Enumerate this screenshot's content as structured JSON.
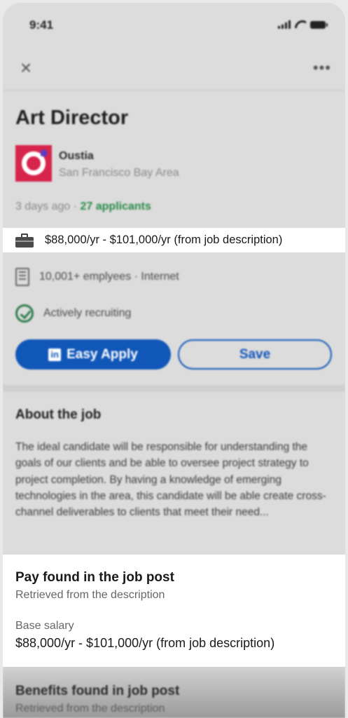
{
  "status_bar": {
    "time": "9:41"
  },
  "nav": {
    "close_glyph": "×",
    "more_glyph": "•••"
  },
  "job": {
    "title": "Art Director",
    "company": "Oustia",
    "location": "San Francisco Bay Area",
    "posted": "3 days ago",
    "separator": " · ",
    "applicants": "27 applicants"
  },
  "salary_highlight": "$88,000/yr - $101,000/yr (from job description)",
  "details": {
    "employees": "10,001+ emplyees · Internet",
    "recruiting": "Actively recruiting"
  },
  "actions": {
    "easy_apply_label": "Easy Apply",
    "in_badge": "in",
    "save_label": "Save"
  },
  "about": {
    "title": "About the job",
    "text": "The ideal candidate will be responsible for understanding the goals of our clients and be able to oversee project strategy to project completion. By having a knowledge of emerging technologies in the area, this candidate will be able create cross-channel deliverables to clients that meet their need..."
  },
  "pay_card": {
    "title": "Pay found in the job post",
    "subtitle": "Retrieved from the description",
    "base_label": "Base salary",
    "base_value": "$88,000/yr - $101,000/yr (from job description)"
  },
  "benefits": {
    "title": "Benefits found in job post",
    "subtitle": "Retrieved from the description"
  },
  "colors": {
    "accent": "#1157b8",
    "brand_logo": "#d6244a",
    "applicants_green": "#2a8b4a",
    "highlight_bg": "#ffffff"
  },
  "icons": [
    "signal-icon",
    "wifi-icon",
    "battery-icon",
    "close-icon",
    "more-icon",
    "company-logo",
    "briefcase-icon",
    "building-icon",
    "recruiting-check-icon",
    "linkedin-icon"
  ]
}
